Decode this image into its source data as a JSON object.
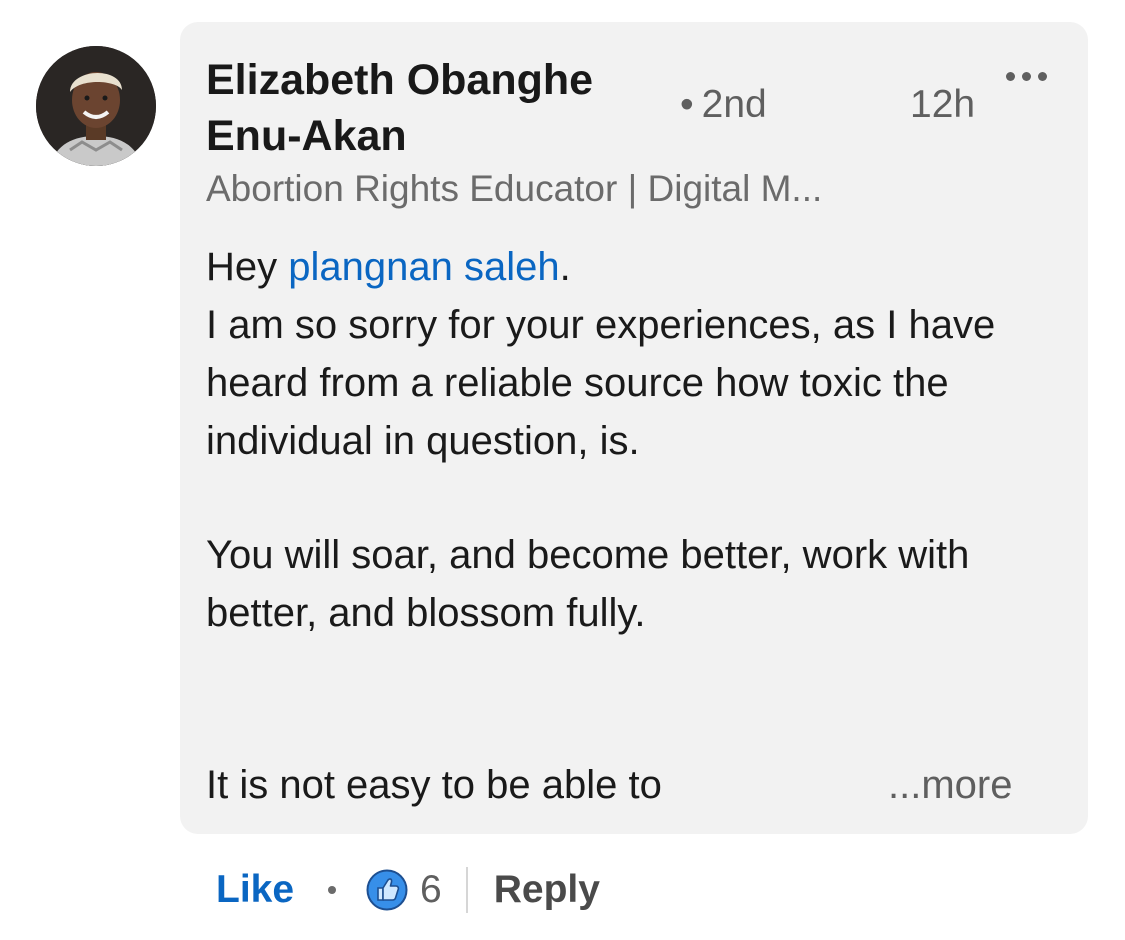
{
  "comment": {
    "author_name": "Elizabeth Obanghe Enu-Akan",
    "connection_degree": "2nd",
    "dot": "•",
    "timestamp": "12h",
    "headline": "Abortion Rights Educator | Digital M...",
    "greeting": "Hey ",
    "mention": "plangnan saleh",
    "greeting_end": ".",
    "paragraph_1": "I am so sorry for your experiences, as I have heard from a reliable source how toxic the individual in question, is.",
    "paragraph_2": "You will soar, and become better, work with better, and blossom fully.",
    "paragraph_3": "It is not easy to be able to",
    "see_more": "...more",
    "more_menu_icon": "more-horizontal-icon"
  },
  "actions": {
    "like_label": "Like",
    "reaction_icon": "thumbs-up-icon",
    "reaction_count": "6",
    "reply_label": "Reply"
  },
  "colors": {
    "link_blue": "#0a66c2",
    "bubble_bg": "#f2f2f2",
    "secondary_text": "#5f5f5f"
  }
}
